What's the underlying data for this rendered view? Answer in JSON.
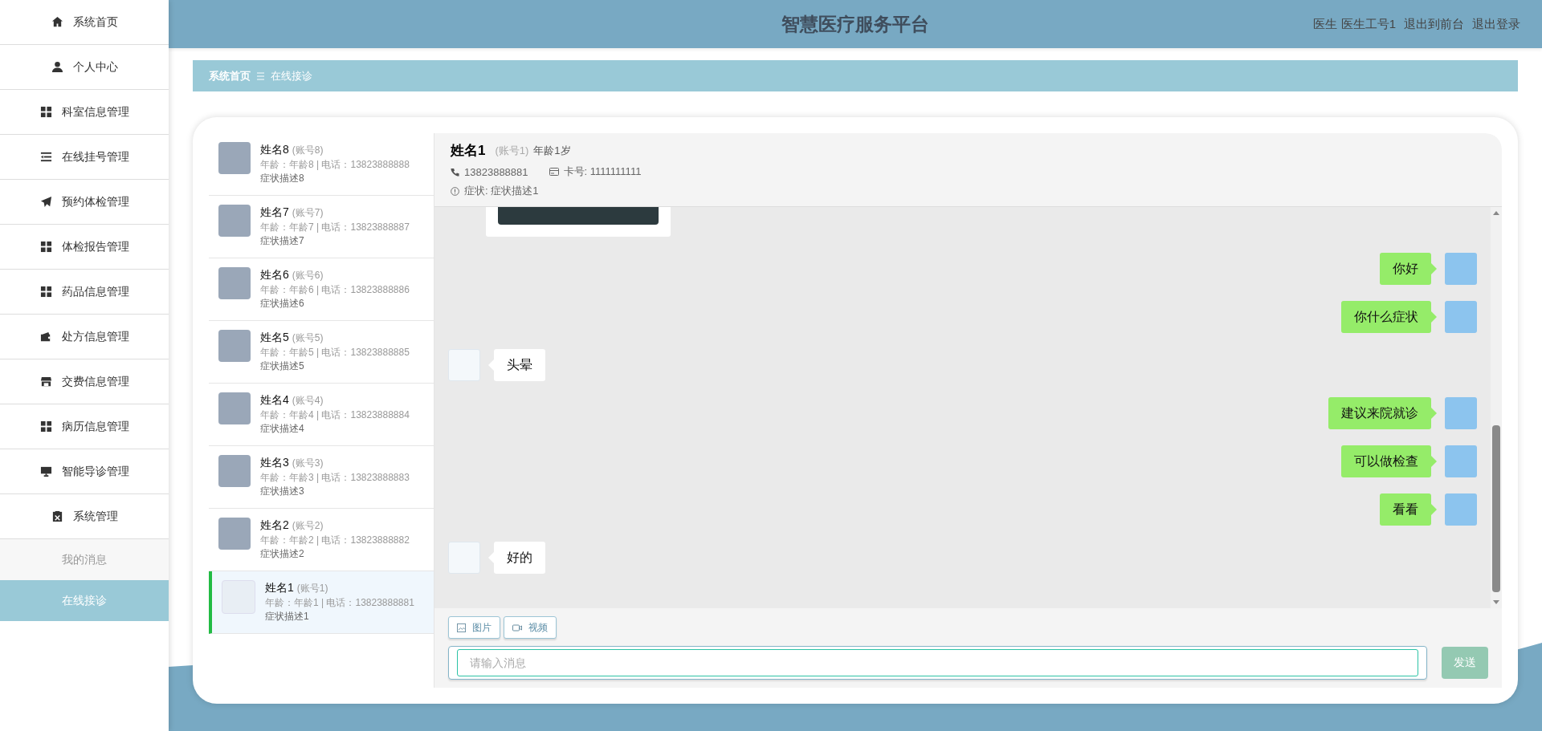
{
  "header": {
    "title": "智慧医疗服务平台",
    "user": "医生 医生工号1",
    "links": [
      "退出到前台",
      "退出登录"
    ]
  },
  "sidebar": {
    "items": [
      {
        "label": "系统首页",
        "selected": false
      },
      {
        "label": "个人中心",
        "selected": false
      },
      {
        "label": "科室信息管理",
        "selected": false
      },
      {
        "label": "在线挂号管理",
        "selected": false
      },
      {
        "label": "预约体检管理",
        "selected": false
      },
      {
        "label": "体检报告管理",
        "selected": false
      },
      {
        "label": "药品信息管理",
        "selected": false
      },
      {
        "label": "处方信息管理",
        "selected": false
      },
      {
        "label": "交费信息管理",
        "selected": false
      },
      {
        "label": "病历信息管理",
        "selected": false
      },
      {
        "label": "智能导诊管理",
        "selected": false
      },
      {
        "label": "系统管理",
        "selected": false,
        "expanded": true,
        "children": [
          {
            "label": "我的消息",
            "selected": false
          },
          {
            "label": "在线接诊",
            "selected": true
          }
        ]
      }
    ]
  },
  "breadcrumb": [
    "系统首页",
    "在线接诊"
  ],
  "patients": [
    {
      "name": "姓名8",
      "account": "(账号8)",
      "info": "年龄：年龄8 | 电话：13823888888",
      "symptom": "症状描述8",
      "selected": false
    },
    {
      "name": "姓名7",
      "account": "(账号7)",
      "info": "年龄：年龄7 | 电话：13823888887",
      "symptom": "症状描述7",
      "selected": false
    },
    {
      "name": "姓名6",
      "account": "(账号6)",
      "info": "年龄：年龄6 | 电话：13823888886",
      "symptom": "症状描述6",
      "selected": false
    },
    {
      "name": "姓名5",
      "account": "(账号5)",
      "info": "年龄：年龄5 | 电话：13823888885",
      "symptom": "症状描述5",
      "selected": false
    },
    {
      "name": "姓名4",
      "account": "(账号4)",
      "info": "年龄：年龄4 | 电话：13823888884",
      "symptom": "症状描述4",
      "selected": false
    },
    {
      "name": "姓名3",
      "account": "(账号3)",
      "info": "年龄：年龄3 | 电话：13823888883",
      "symptom": "症状描述3",
      "selected": false
    },
    {
      "name": "姓名2",
      "account": "(账号2)",
      "info": "年龄：年龄2 | 电话：13823888882",
      "symptom": "症状描述2",
      "selected": false
    },
    {
      "name": "姓名1",
      "account": "(账号1)",
      "info": "年龄：年龄1 | 电话：13823888881",
      "symptom": "症状描述1",
      "selected": true
    }
  ],
  "chat": {
    "name": "姓名1",
    "account": "(账号1)",
    "age": "年龄1岁",
    "phone": "13823888881",
    "card": "卡号: 1111111111",
    "symptom": "症状: 症状描述1",
    "messages": [
      {
        "kind": "incoming-image"
      },
      {
        "kind": "outgoing",
        "text": "你好"
      },
      {
        "kind": "outgoing",
        "text": "你什么症状"
      },
      {
        "kind": "incoming",
        "text": "头晕"
      },
      {
        "kind": "outgoing",
        "text": "建议来院就诊"
      },
      {
        "kind": "outgoing",
        "text": "可以做检查"
      },
      {
        "kind": "outgoing",
        "text": "看看"
      },
      {
        "kind": "incoming",
        "text": "好的"
      }
    ],
    "tools": [
      {
        "kind": "image",
        "label": "图片"
      },
      {
        "kind": "video",
        "label": "视频"
      }
    ],
    "input": {
      "placeholder": "请输入消息"
    },
    "send": "发送"
  }
}
